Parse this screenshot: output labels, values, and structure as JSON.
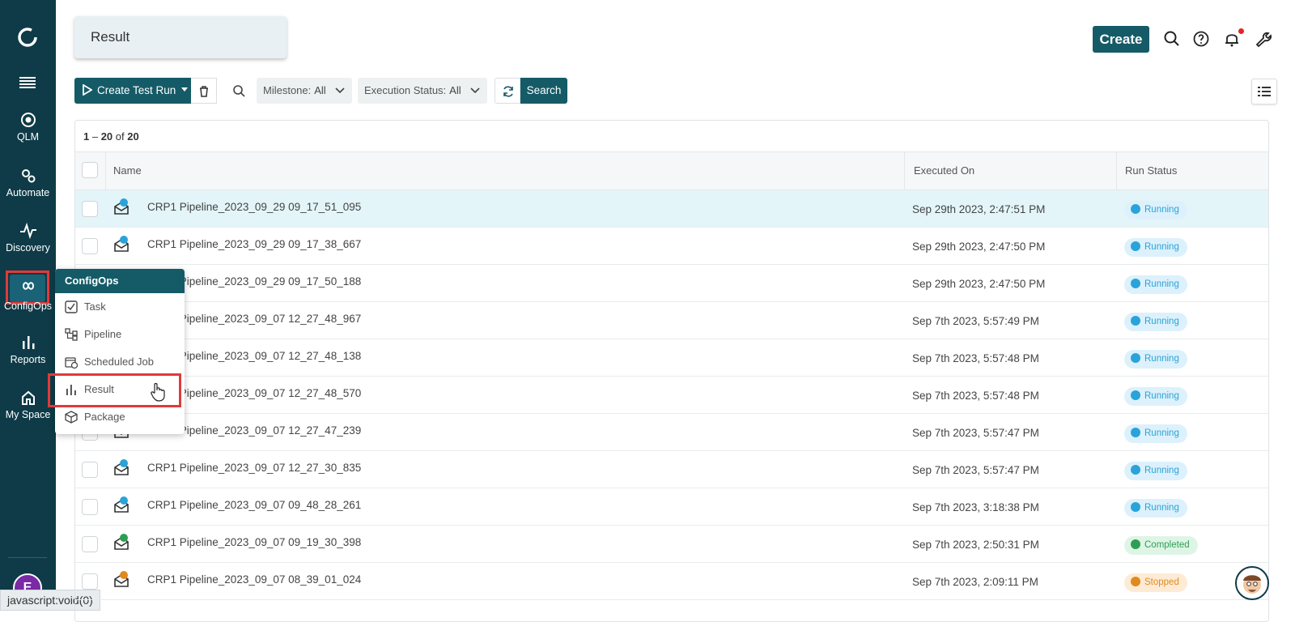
{
  "sidebar": {
    "items": [
      {
        "label": "QLM",
        "icon": "target-icon"
      },
      {
        "label": "Automate",
        "icon": "gears-icon"
      },
      {
        "label": "Discovery",
        "icon": "pulse-icon"
      },
      {
        "label": "ConfigOps",
        "icon": "infinity-icon"
      },
      {
        "label": "Reports",
        "icon": "bar-chart-icon"
      },
      {
        "label": "My Space",
        "icon": "home-icon"
      }
    ],
    "avatar_initial": "E"
  },
  "statusbar": {
    "url": "javascript:void(0)"
  },
  "header": {
    "page_title": "Result",
    "create_label": "Create"
  },
  "toolbar": {
    "create_test_run_label": "Create Test Run",
    "milestone_label": "Milestone:",
    "milestone_value": "All",
    "execution_status_label": "Execution Status:",
    "execution_status_value": "All",
    "search_label": "Search"
  },
  "table": {
    "count_from": "1",
    "count_to": "20",
    "count_of": "of",
    "count_total": "20",
    "columns": [
      "Name",
      "Executed On",
      "Run Status"
    ],
    "rows": [
      {
        "name": "CRP1 Pipeline_2023_09_29 09_17_51_095",
        "executed": "Sep 29th 2023, 2:47:51 PM",
        "status": "Running"
      },
      {
        "name": "CRP1 Pipeline_2023_09_29 09_17_38_667",
        "executed": "Sep 29th 2023, 2:47:50 PM",
        "status": "Running"
      },
      {
        "name": "CRP1 Pipeline_2023_09_29 09_17_50_188",
        "executed": "Sep 29th 2023, 2:47:50 PM",
        "status": "Running"
      },
      {
        "name": "CRP1 Pipeline_2023_09_07 12_27_48_967",
        "executed": "Sep 7th 2023, 5:57:49 PM",
        "status": "Running"
      },
      {
        "name": "CRP1 Pipeline_2023_09_07 12_27_48_138",
        "executed": "Sep 7th 2023, 5:57:48 PM",
        "status": "Running"
      },
      {
        "name": "CRP1 Pipeline_2023_09_07 12_27_48_570",
        "executed": "Sep 7th 2023, 5:57:48 PM",
        "status": "Running"
      },
      {
        "name": "CRP1 Pipeline_2023_09_07 12_27_47_239",
        "executed": "Sep 7th 2023, 5:57:47 PM",
        "status": "Running"
      },
      {
        "name": "CRP1 Pipeline_2023_09_07 12_27_30_835",
        "executed": "Sep 7th 2023, 5:57:47 PM",
        "status": "Running"
      },
      {
        "name": "CRP1 Pipeline_2023_09_07 09_48_28_261",
        "executed": "Sep 7th 2023, 3:18:38 PM",
        "status": "Running"
      },
      {
        "name": "CRP1 Pipeline_2023_09_07 09_19_30_398",
        "executed": "Sep 7th 2023, 2:50:31 PM",
        "status": "Completed"
      },
      {
        "name": "CRP1 Pipeline_2023_09_07 08_39_01_024",
        "executed": "Sep 7th 2023, 2:09:11 PM",
        "status": "Stopped"
      }
    ]
  },
  "configops_menu": {
    "title": "ConfigOps",
    "items": [
      "Task",
      "Pipeline",
      "Scheduled Job",
      "Result",
      "Package"
    ]
  },
  "colors": {
    "sidebar_bg": "#0e3b47",
    "primary": "#155b67",
    "running": "#2aa3d9",
    "completed": "#2e9e55",
    "stopped": "#e08a1e",
    "highlight": "#e03a3a"
  }
}
